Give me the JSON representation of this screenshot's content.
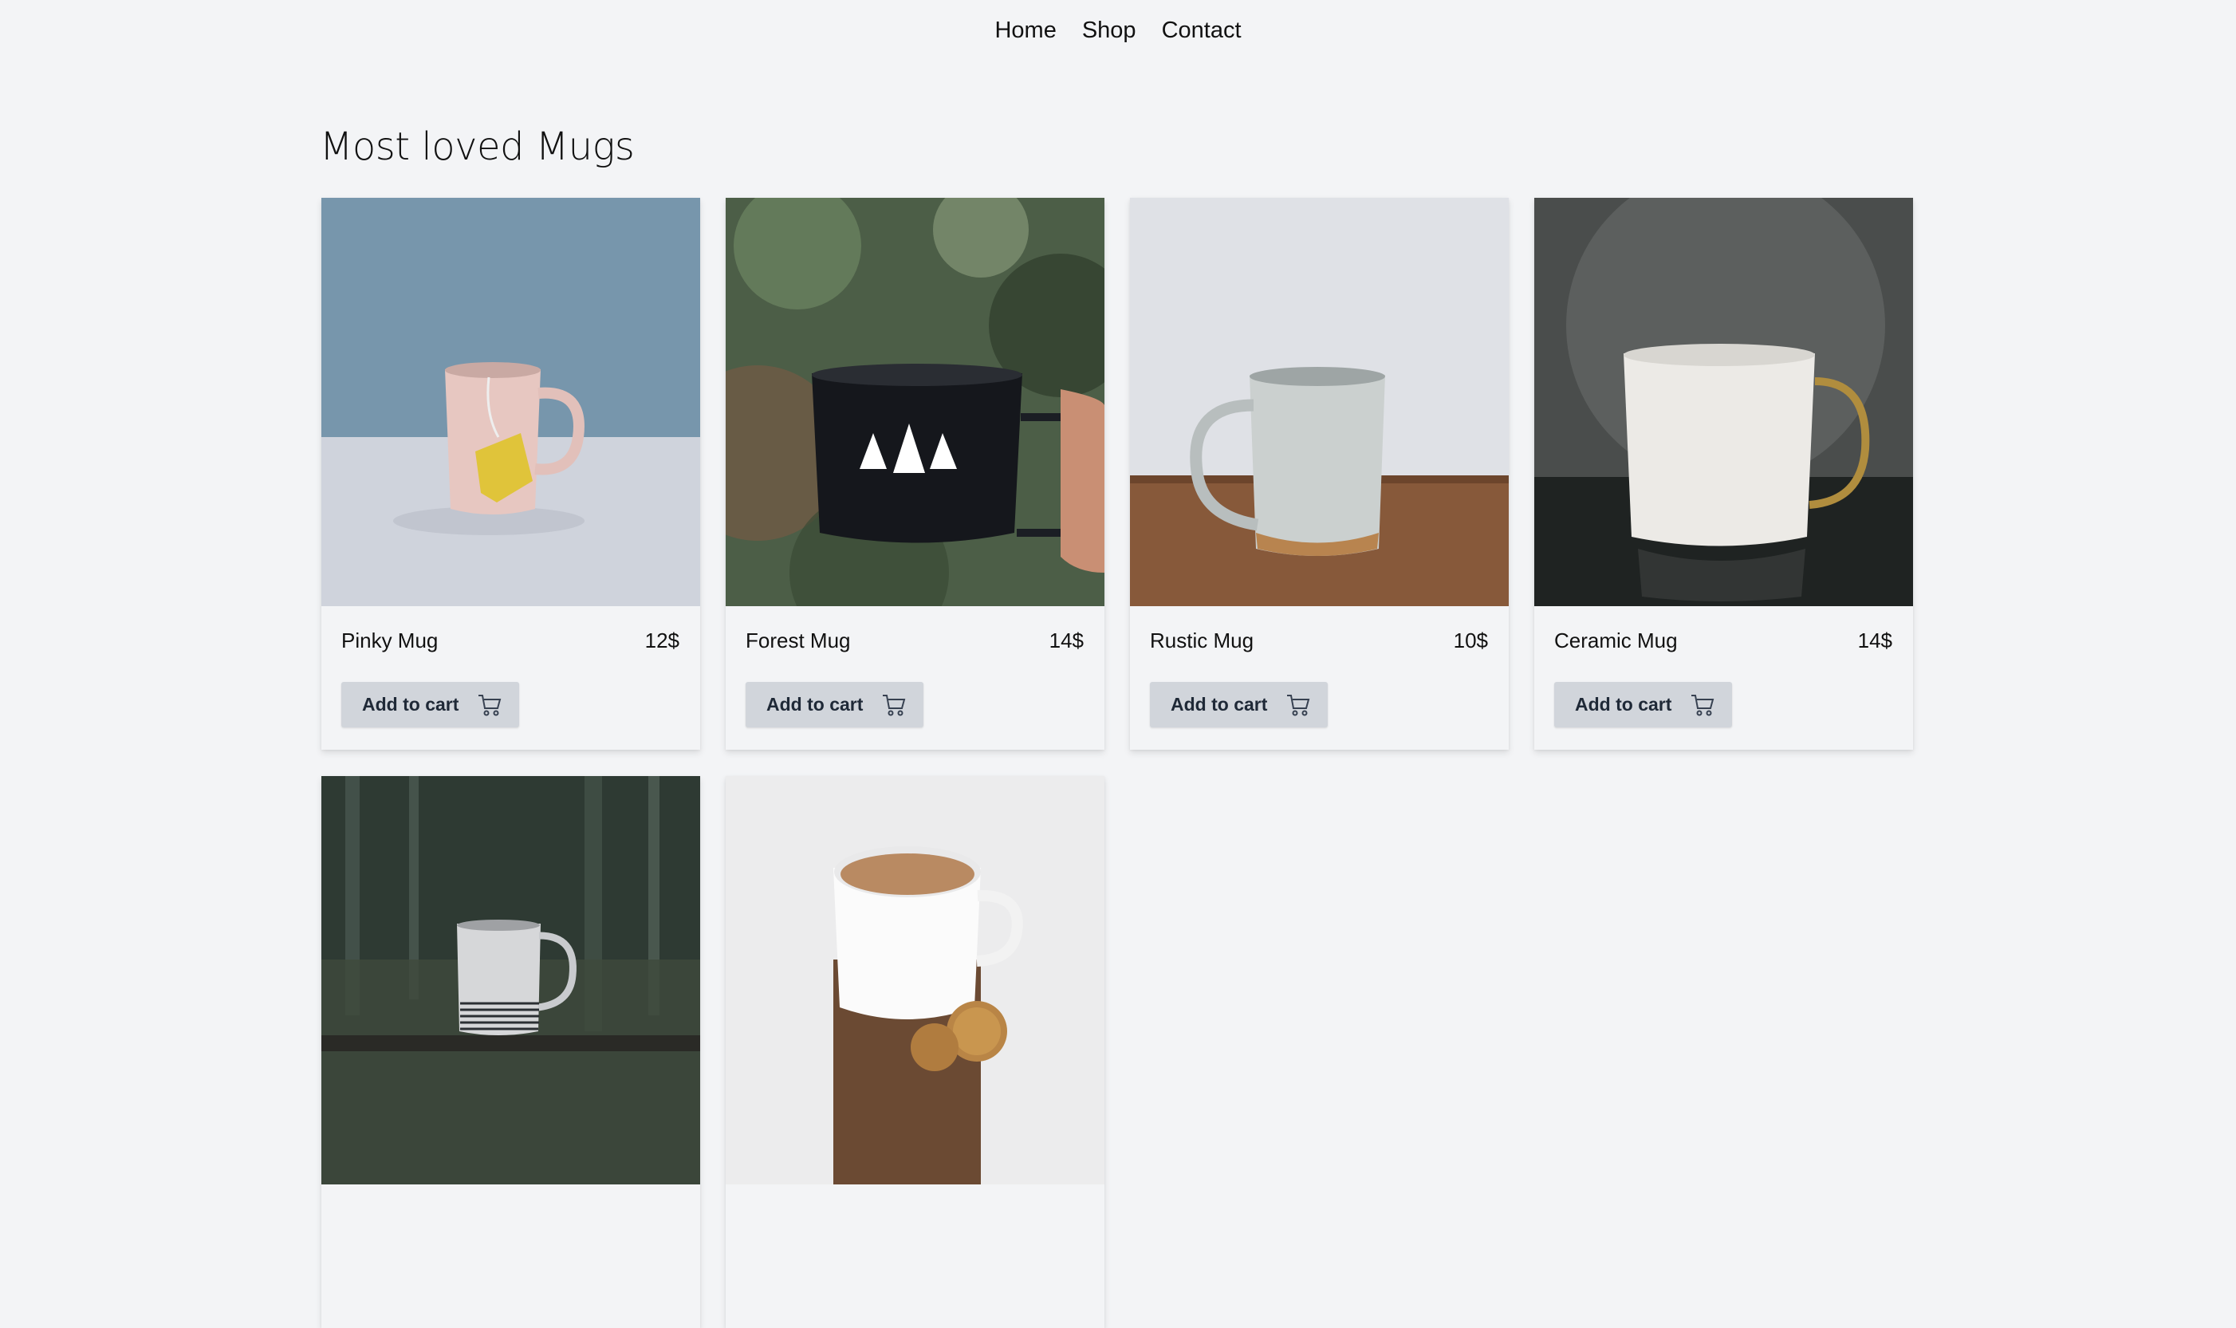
{
  "nav": {
    "items": [
      {
        "label": "Home"
      },
      {
        "label": "Shop"
      },
      {
        "label": "Contact"
      }
    ]
  },
  "page": {
    "title": "Most loved Mugs"
  },
  "products": [
    {
      "name": "Pinky Mug",
      "price": "12$",
      "button_label": "Add to cart",
      "icon": "cart-icon"
    },
    {
      "name": "Forest Mug",
      "price": "14$",
      "button_label": "Add to cart",
      "icon": "cart-icon"
    },
    {
      "name": "Rustic Mug",
      "price": "10$",
      "button_label": "Add to cart",
      "icon": "cart-icon"
    },
    {
      "name": "Ceramic Mug",
      "price": "14$",
      "button_label": "Add to cart",
      "icon": "cart-icon"
    },
    {
      "name": "",
      "price": "",
      "button_label": "",
      "icon": "cart-icon"
    },
    {
      "name": "",
      "price": "",
      "button_label": "",
      "icon": "cart-icon"
    }
  ],
  "colors": {
    "background": "#f3f4f6",
    "button": "#d1d5db",
    "button_text": "#1f2937"
  }
}
